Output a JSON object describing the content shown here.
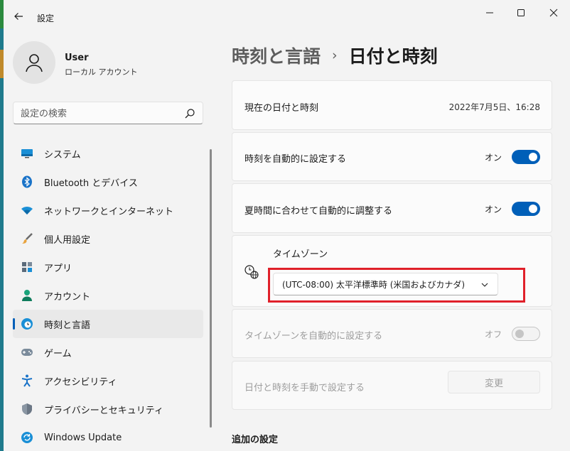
{
  "app": {
    "title": "設定"
  },
  "user": {
    "name": "User",
    "account_type": "ローカル アカウント"
  },
  "search": {
    "placeholder": "設定の検索"
  },
  "nav": [
    {
      "label": "システム",
      "icon": "monitor-icon"
    },
    {
      "label": "Bluetooth とデバイス",
      "icon": "bluetooth-icon"
    },
    {
      "label": "ネットワークとインターネット",
      "icon": "wifi-icon"
    },
    {
      "label": "個人用設定",
      "icon": "brush-icon"
    },
    {
      "label": "アプリ",
      "icon": "apps-icon"
    },
    {
      "label": "アカウント",
      "icon": "person-icon"
    },
    {
      "label": "時刻と言語",
      "icon": "clock-globe-icon",
      "selected": true
    },
    {
      "label": "ゲーム",
      "icon": "gamepad-icon"
    },
    {
      "label": "アクセシビリティ",
      "icon": "accessibility-icon"
    },
    {
      "label": "プライバシーとセキュリティ",
      "icon": "shield-icon"
    },
    {
      "label": "Windows Update",
      "icon": "update-icon"
    }
  ],
  "breadcrumb": {
    "parent": "時刻と言語",
    "separator": "›",
    "current": "日付と時刻"
  },
  "current_datetime": {
    "label": "現在の日付と時刻",
    "value": "2022年7月5日、16:28"
  },
  "auto_time": {
    "label": "時刻を自動的に設定する",
    "state_text": "オン",
    "on": true
  },
  "dst": {
    "label": "夏時間に合わせて自動的に調整する",
    "state_text": "オン",
    "on": true
  },
  "timezone": {
    "label": "タイムゾーン",
    "selected": "(UTC-08:00) 太平洋標準時 (米国およびカナダ)"
  },
  "auto_timezone": {
    "label": "タイムゾーンを自動的に設定する",
    "state_text": "オフ",
    "on": false
  },
  "manual": {
    "label": "日付と時刻を手動で設定する",
    "button": "変更"
  },
  "additional": {
    "title": "追加の設定"
  },
  "colors": {
    "accent": "#005fb8",
    "highlight": "#e0202a"
  }
}
